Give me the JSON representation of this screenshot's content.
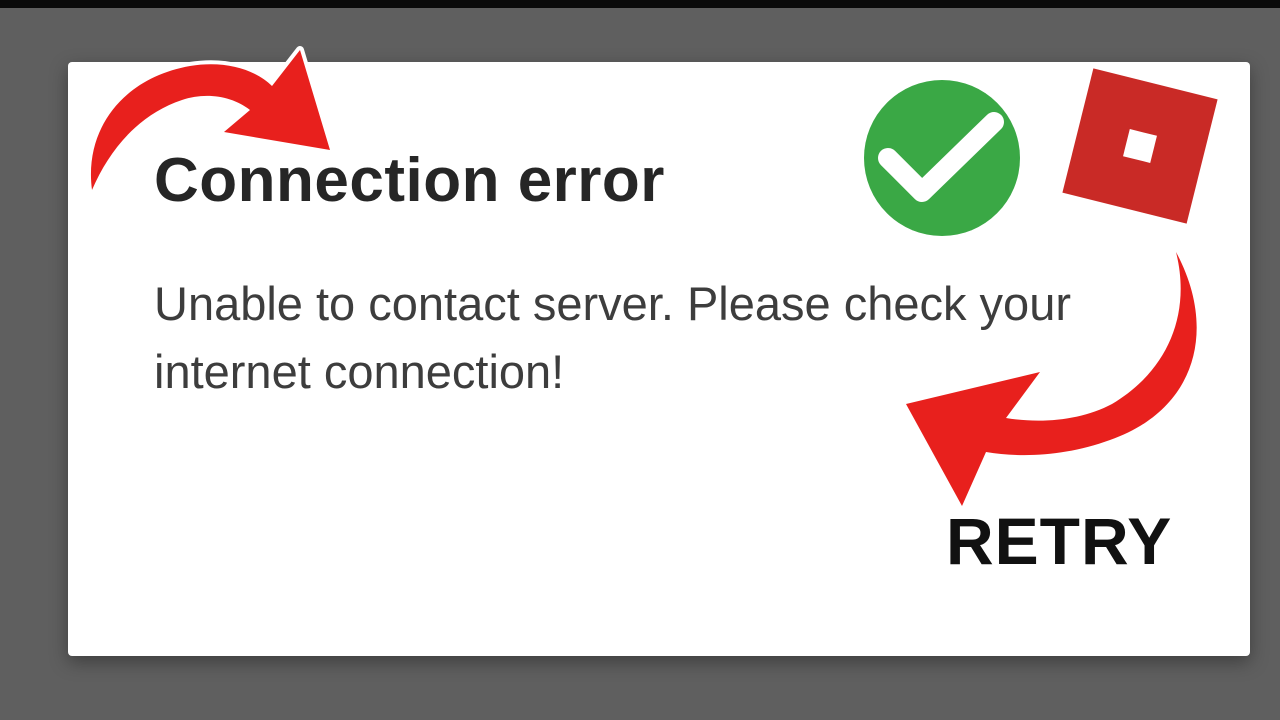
{
  "dialog": {
    "title": "Connection error",
    "message": "Unable to contact server. Please check your internet connection!",
    "retry_label": "RETRY"
  },
  "icons": {
    "check": "check-icon",
    "app_logo": "roblox-logo-icon",
    "arrows": [
      "arrow-curved-right-icon",
      "arrow-curved-left-icon"
    ]
  },
  "colors": {
    "background": "#5f5f5f",
    "dialog": "#ffffff",
    "arrow": "#e8201d",
    "check_circle": "#3aa845",
    "logo": "#c92a26",
    "title_text": "#262626",
    "body_text": "#3d3d3d"
  }
}
